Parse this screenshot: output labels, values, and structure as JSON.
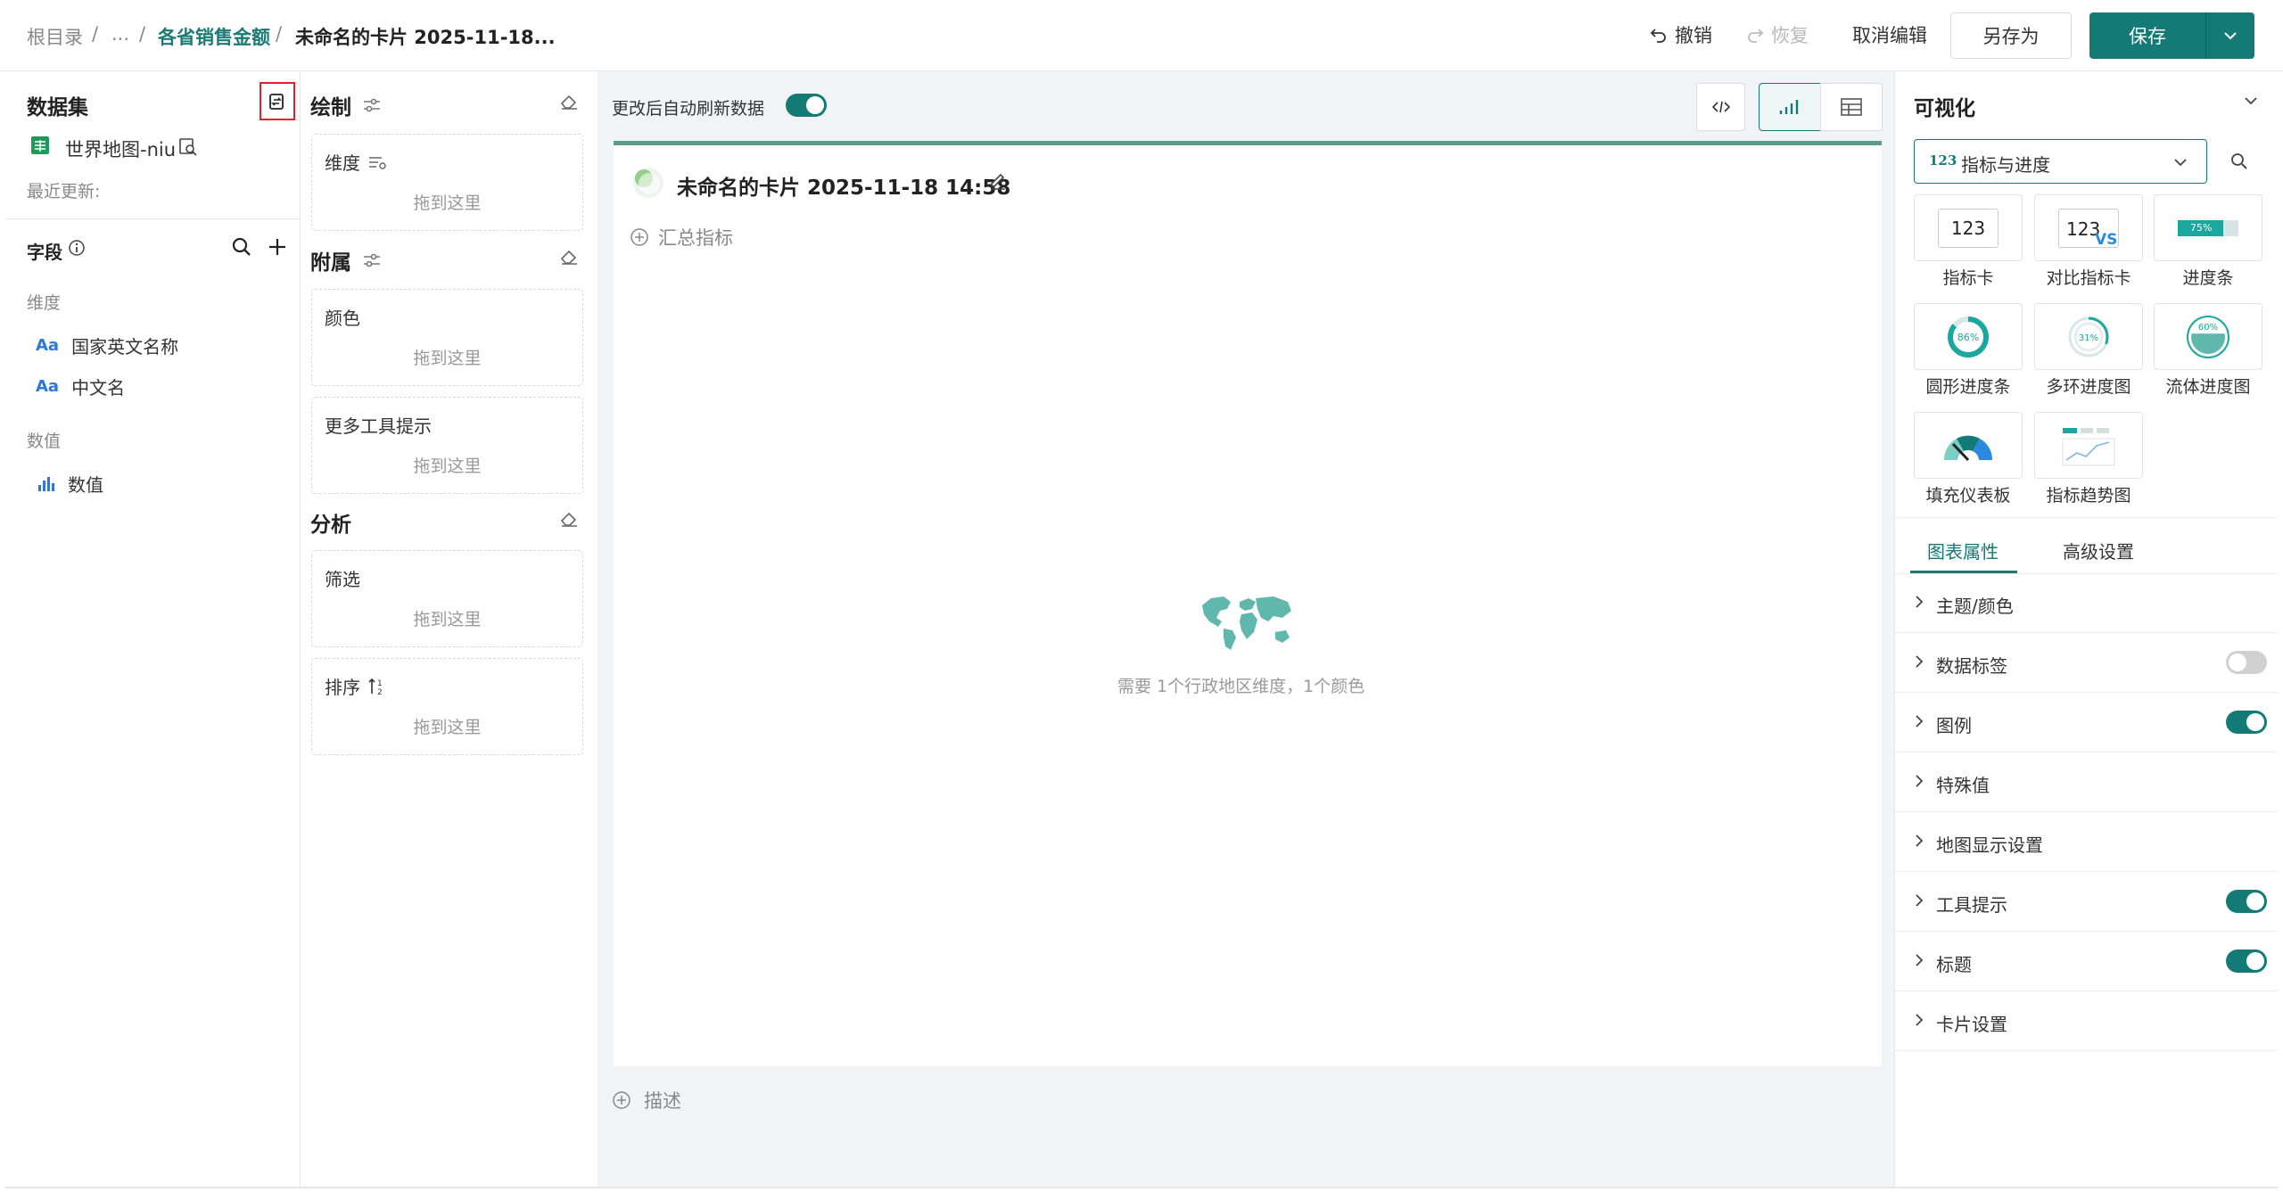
{
  "breadcrumb": {
    "root": "根目录",
    "sep1": "/",
    "ellipsis": "...",
    "sep2": "/",
    "parent": "各省销售金额",
    "sep3": "/",
    "current": "未命名的卡片 2025-11-18..."
  },
  "header": {
    "undo": "撤销",
    "redo": "恢复",
    "cancel_edit": "取消编辑",
    "save_as": "另存为",
    "save": "保存"
  },
  "dataset": {
    "title": "数据集",
    "name": "世界地图-niu",
    "updated_label": "最近更新:"
  },
  "fields": {
    "title": "字段",
    "dimension_label": "维度",
    "dimensions": [
      "国家英文名称",
      "中文名"
    ],
    "measure_label": "数值",
    "measures": [
      "数值"
    ],
    "dim_type_glyph": "Aa"
  },
  "config": {
    "draw_title": "绘制",
    "dimension_label": "维度",
    "attach_title": "附属",
    "color_label": "颜色",
    "tooltip_label": "更多工具提示",
    "analysis_title": "分析",
    "filter_label": "筛选",
    "sort_label": "排序",
    "drop_hint": "拖到这里"
  },
  "canvas": {
    "auto_refresh_label": "更改后自动刷新数据",
    "auto_refresh_on": true,
    "card_title": "未命名的卡片 2025-11-18 14:58",
    "add_metric": "汇总指标",
    "empty_hint": "需要 1个行政地区维度，1个颜色",
    "describe": "描述",
    "accent_color": "#137a76"
  },
  "viz": {
    "title": "可视化",
    "selected_type": "指标与进度",
    "selected_type_glyph": "123",
    "tiles": [
      {
        "label": "指标卡",
        "icon": "metric-card-icon",
        "text": "123"
      },
      {
        "label": "对比指标卡",
        "icon": "compare-metric-card-icon",
        "text": "123",
        "vs": "VS"
      },
      {
        "label": "进度条",
        "icon": "progress-bar-icon",
        "text": "75%",
        "progress": 0.75
      },
      {
        "label": "圆形进度条",
        "icon": "circular-progress-icon",
        "text": "86%",
        "progress": 0.86
      },
      {
        "label": "多环进度图",
        "icon": "multi-ring-progress-icon",
        "text": "31%",
        "progress": 0.31
      },
      {
        "label": "流体进度图",
        "icon": "liquid-progress-icon",
        "text": "60%",
        "progress": 0.6
      },
      {
        "label": "填充仪表板",
        "icon": "filled-gauge-icon"
      },
      {
        "label": "指标趋势图",
        "icon": "metric-trend-icon"
      }
    ],
    "tabs": [
      "图表属性",
      "高级设置"
    ],
    "properties": [
      {
        "label": "主题/颜色"
      },
      {
        "label": "数据标签",
        "toggle": false
      },
      {
        "label": "图例",
        "toggle": true
      },
      {
        "label": "特殊值"
      },
      {
        "label": "地图显示设置"
      },
      {
        "label": "工具提示",
        "toggle": true
      },
      {
        "label": "标题",
        "toggle": true
      },
      {
        "label": "卡片设置"
      }
    ]
  }
}
